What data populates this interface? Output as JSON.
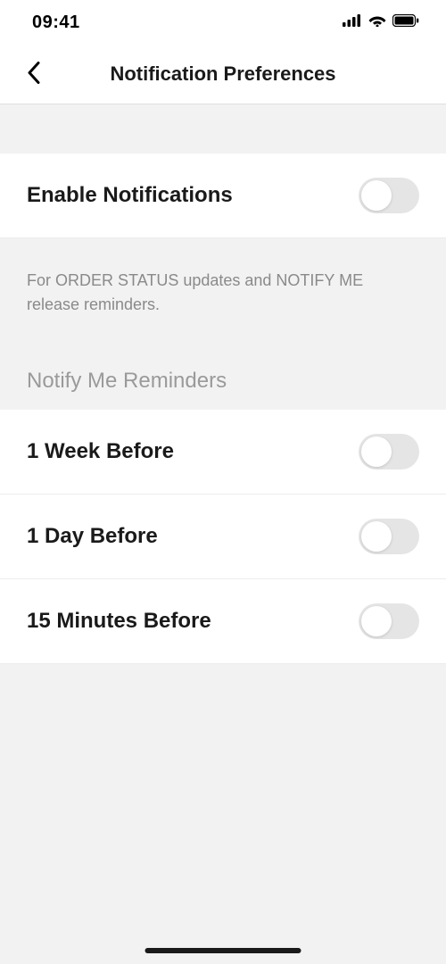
{
  "status": {
    "time": "09:41"
  },
  "header": {
    "title": "Notification Preferences"
  },
  "rows": {
    "enable": {
      "label": "Enable Notifications",
      "checked": false
    }
  },
  "description": "For ORDER STATUS updates and NOTIFY ME release reminders.",
  "section": {
    "title": "Notify Me Reminders"
  },
  "reminders": [
    {
      "label": "1 Week Before",
      "checked": false
    },
    {
      "label": "1 Day Before",
      "checked": false
    },
    {
      "label": "15 Minutes Before",
      "checked": false
    }
  ]
}
